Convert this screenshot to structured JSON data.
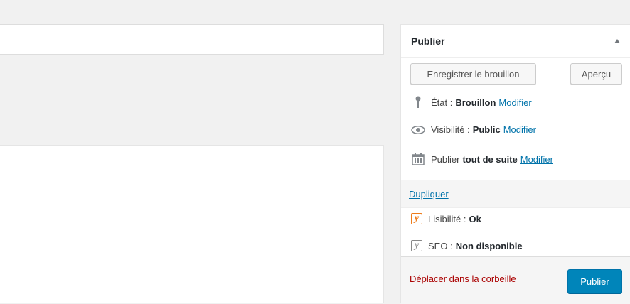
{
  "publish": {
    "title": "Publier",
    "save_draft_label": "Enregistrer le brouillon",
    "preview_label": "Aperçu",
    "status": {
      "label": "État :",
      "value": "Brouillon",
      "edit": "Modifier"
    },
    "visibility": {
      "label": "Visibilité :",
      "value": "Public",
      "edit": "Modifier"
    },
    "schedule": {
      "label": "Publier",
      "value": "tout de suite",
      "edit": "Modifier"
    },
    "duplicate_label": "Dupliquer",
    "readability": {
      "label": "Lisibilité :",
      "value": "Ok"
    },
    "seo": {
      "label": "SEO :",
      "value": "Non disponible"
    },
    "trash_label": "Déplacer dans la corbeille",
    "publish_label": "Publier"
  },
  "colors": {
    "link": "#0073aa",
    "primary_button": "#0085ba",
    "trash": "#a00000",
    "yoast_ok": "#ee7c1b"
  }
}
